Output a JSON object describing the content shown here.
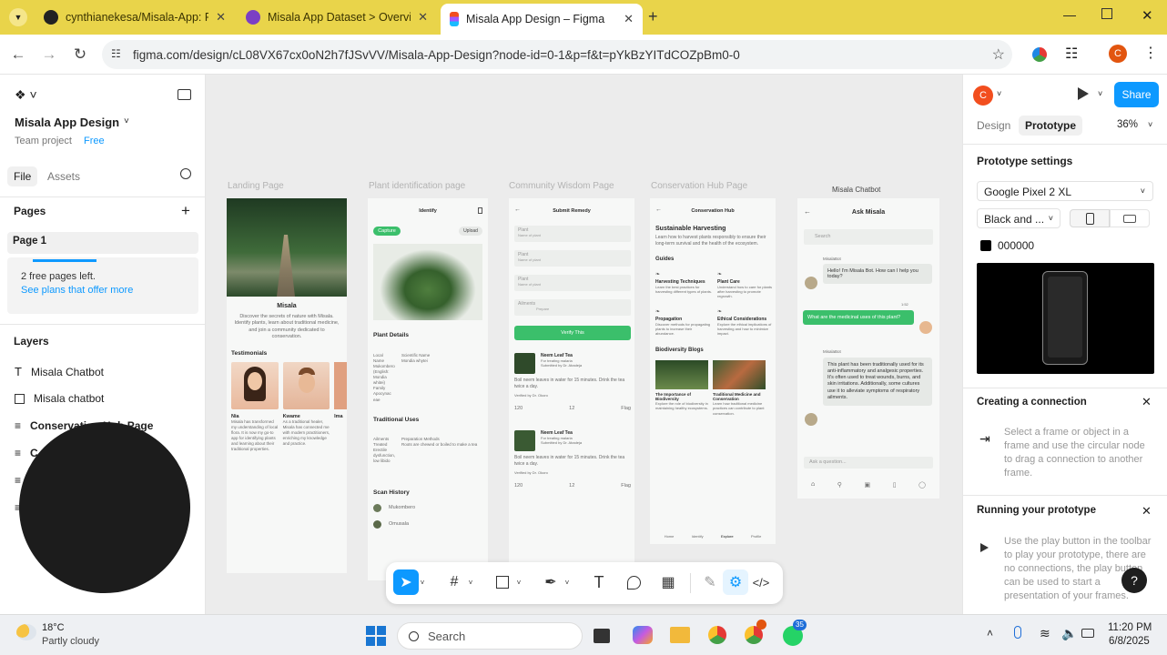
{
  "browser": {
    "tabs": [
      {
        "title": "cynthianekesa/Misala-App: Fina",
        "favicon": "github-icon"
      },
      {
        "title": "Misala App Dataset > Overview",
        "favicon": "data-icon"
      },
      {
        "title": "Misala App Design – Figma",
        "favicon": "figma-icon"
      }
    ],
    "url": "figma.com/design/cL08VX67cx0oN2h7fJSvVV/Misala-App-Design?node-id=0-1&p=f&t=pYkBzYITdCOZpBm0-0",
    "profile_initial": "C"
  },
  "sidebar": {
    "file_title": "Misala App Design",
    "team_label": "Team project",
    "plan_badge": "Free",
    "tab_file": "File",
    "tab_assets": "Assets",
    "pages_heading": "Pages",
    "current_page": "Page 1",
    "free_pages_text": "2 free pages left.",
    "plans_link": "See plans that offer more",
    "layers_heading": "Layers",
    "layers": [
      {
        "name": "Misala Chatbot",
        "icon": "text-icon"
      },
      {
        "name": "Misala chatbot",
        "icon": "image-icon"
      },
      {
        "name": "Conservation Hub Page",
        "icon": "frame-icon"
      },
      {
        "name": "C",
        "icon": "frame-icon"
      },
      {
        "name": "",
        "icon": "frame-icon"
      },
      {
        "name": "",
        "icon": "frame-icon"
      }
    ]
  },
  "canvas": {
    "frame_titles": [
      "Landing Page",
      "Plant identification page",
      "Community Wisdom Page",
      "Conservation Hub Page",
      "Misala Chatbot"
    ],
    "landing": {
      "brand": "Misala",
      "tagline": "Discover the secrets of nature with Misala. Identify plants, learn about traditional medicine, and join a community dedicated to conservation.",
      "testimonials_heading": "Testimonials",
      "people": [
        {
          "name": "Nia",
          "quote": "Misala has transformed my understanding of local flora. It is now my go-to app for identifying plants and learning about their traditional properties."
        },
        {
          "name": "Kwame",
          "quote": "As a traditional healer, Misala has connected me with modern practitioners, enriching my knowledge and practice."
        },
        {
          "name": "Ima",
          "quote": ""
        }
      ]
    },
    "identify": {
      "header": "Identify",
      "capture": "Capture",
      "upload": "Upload",
      "plant_details": "Plant Details",
      "details_left": [
        "Local",
        "Name",
        "Mukombero",
        "(English:",
        "Mondia",
        "whitei)",
        "Family",
        "Apocynac",
        "eae"
      ],
      "details_right": [
        "Scientific Name",
        "Mondia whytei"
      ],
      "traditional_uses": "Traditional Uses",
      "uses_left": [
        "Ailments",
        "Treated",
        "Erectile",
        "dysfunction,",
        "low libido"
      ],
      "uses_right": [
        "Preparation Methods",
        "Roots are chewed or boiled to make a tea"
      ],
      "scan_history": "Scan History",
      "history": [
        "Mukombero",
        "Omusala"
      ]
    },
    "remedy": {
      "header": "Submit Remedy",
      "fields": [
        "Plant",
        "Plant",
        "Plant",
        "Ailments"
      ],
      "field_hints": [
        "Name of plant",
        "Name of plant",
        "Name of plant",
        "Prepare"
      ],
      "verify_button": "Verify This",
      "posts": [
        {
          "title": "Neem Leaf Tea",
          "sub": "For treating malaria",
          "author": "Submitted by Dr. Abadeja",
          "body": "Boil neem leaves in water for 15 minutes. Drink the tea twice a day.",
          "verified": "Verified by Dr. Okoro",
          "likes": "120",
          "comments": "12",
          "flag": "Flag"
        },
        {
          "title": "Neem Leaf Tea",
          "sub": "For treating malaria",
          "author": "Submitted by Dr. Abadeja",
          "body": "Boil neem leaves in water for 15 minutes. Drink the tea twice a day.",
          "verified": "Verified by Dr. Okoro",
          "likes": "120",
          "comments": "12",
          "flag": "Flag"
        }
      ]
    },
    "conservation": {
      "header": "Conservation Hub",
      "title": "Sustainable Harvesting",
      "intro": "Learn how to harvest plants responsibly to ensure their long-term survival and the health of the ecosystem.",
      "guides_heading": "Guides",
      "guides": [
        {
          "title": "Harvesting Techniques",
          "body": "Learn the best practices for harvesting different types of plants."
        },
        {
          "title": "Plant Care",
          "body": "Understand how to care for plants after harvesting to promote regrowth."
        },
        {
          "title": "Propagation",
          "body": "Discover methods for propagating plants to increase their abundance."
        },
        {
          "title": "Ethical Considerations",
          "body": "Explore the ethical implications of harvesting and how to minimize impact."
        }
      ],
      "blogs_heading": "Biodiversity Blogs",
      "blogs": [
        {
          "title": "The Importance of Biodiversity",
          "body": "Explore the role of biodiversity in maintaining healthy ecosystems."
        },
        {
          "title": "Traditional Medicine and Conservation",
          "body": "Learn how traditional medicine practices can contribute to plant conservation."
        }
      ],
      "nav": [
        "Home",
        "Identify",
        "Explore",
        "Profile"
      ]
    },
    "chatbot": {
      "header": "Ask Misala",
      "search": "Search",
      "bot_label": "MisalaBot",
      "msg1": "Hello! I'm Misala Bot. How can I help you today?",
      "user_time": "1:52",
      "user_msg": "What are the medicinal uses of this plant?",
      "msg2": "This plant has been traditionally used for its anti-inflammatory and analgesic properties. It's often used to treat wounds, burns, and skin irritations. Additionally, some cultures use it to alleviate symptoms of respiratory ailments.",
      "ask_placeholder": "Ask a question..."
    }
  },
  "right_panel": {
    "avatar_initial": "C",
    "share": "Share",
    "tab_design": "Design",
    "tab_prototype": "Prototype",
    "zoom": "36%",
    "proto_settings": "Prototype settings",
    "device": "Google Pixel 2 XL",
    "model": "Black and ...",
    "bg_hex": "000000",
    "creating_heading": "Creating a connection",
    "creating_body": "Select a frame or object in a frame and use the circular node to drag a connection to another frame.",
    "running_heading": "Running your prototype",
    "running_body": "Use the play button in the toolbar to play your prototype, there are no connections, the play button can be used to start a presentation of your frames.",
    "colors": {
      "share": "#0d99ff",
      "avatar": "#f24e1e",
      "accent": "#0d99ff"
    }
  },
  "taskbar": {
    "temp": "18°C",
    "weather": "Partly cloudy",
    "search": "Search",
    "time": "11:20 PM",
    "date": "6/8/2025",
    "whatsapp_badge": "35"
  }
}
